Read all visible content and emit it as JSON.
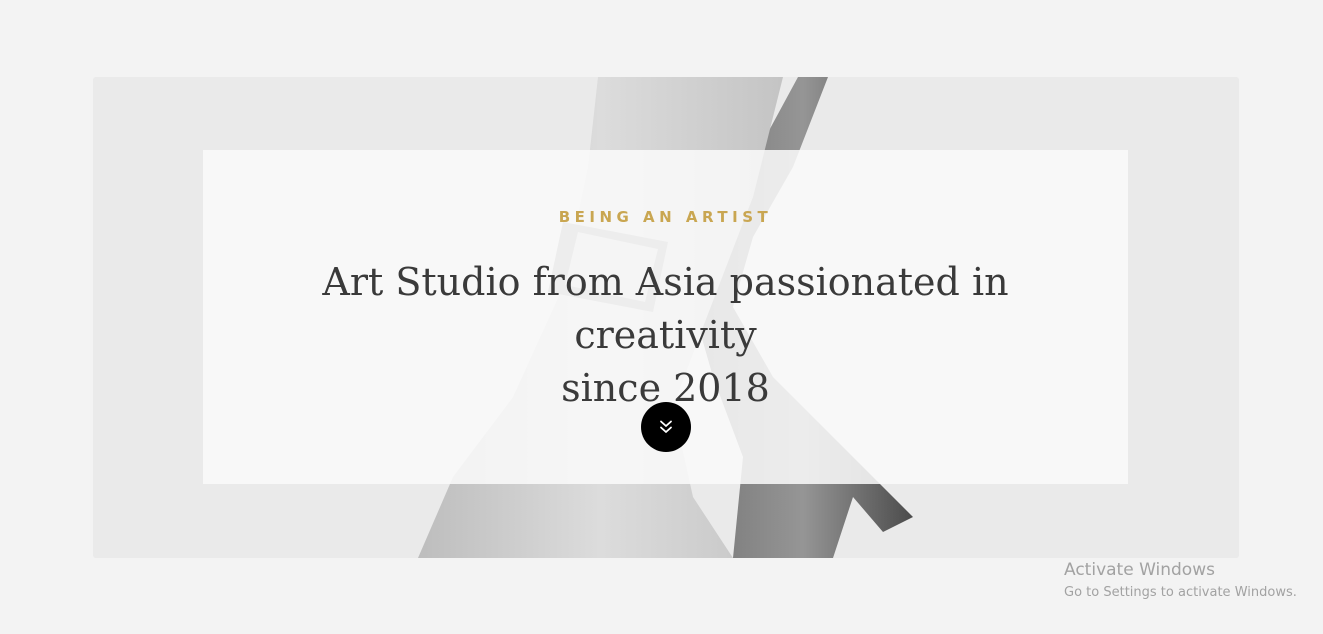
{
  "hero": {
    "kicker": "BEING AN ARTIST",
    "headline_line1": "Art Studio from Asia passionated in creativity",
    "headline_line2": "since 2018",
    "scroll_icon": "double-chevron-down-icon"
  },
  "watermark": {
    "title": "Activate Windows",
    "subtitle": "Go to Settings to activate Windows."
  },
  "colors": {
    "accent": "#c9a651",
    "headline": "#3a3a3a",
    "button": "#000000",
    "page_background": "#f3f3f3"
  }
}
